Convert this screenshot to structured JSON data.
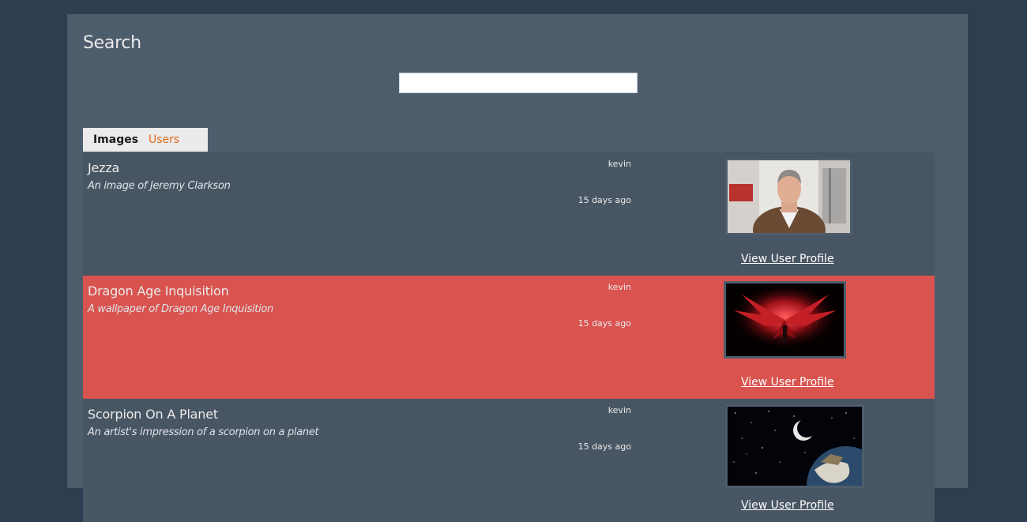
{
  "page": {
    "title": "Search"
  },
  "search": {
    "value": "",
    "placeholder": ""
  },
  "tabs": [
    {
      "label": "Images",
      "active": true
    },
    {
      "label": "Users",
      "active": false
    }
  ],
  "colors": {
    "background": "#2c3e50",
    "panel": "#4e5d6c",
    "row_default": "#485563",
    "row_highlight": "#d9534f",
    "tab_accent": "#df691a"
  },
  "results": [
    {
      "title": "Jezza",
      "description": "An image of Jeremy Clarkson",
      "user": "kevin",
      "time": "15 days ago",
      "link": "View User Profile",
      "thumbnail": "portrait-photo"
    },
    {
      "title": "Dragon Age Inquisition",
      "description": "A wallpaper of Dragon Age Inquisition",
      "user": "kevin",
      "time": "15 days ago",
      "link": "View User Profile",
      "thumbnail": "dragon-wallpaper"
    },
    {
      "title": "Scorpion On A Planet",
      "description": "An artist's impression of a scorpion on a planet",
      "user": "kevin",
      "time": "15 days ago",
      "link": "View User Profile",
      "thumbnail": "space-planet"
    }
  ]
}
